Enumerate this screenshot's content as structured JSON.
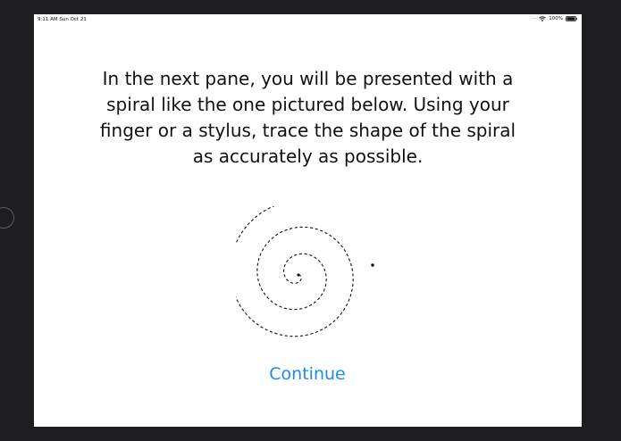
{
  "status_bar": {
    "time_date": "9:11 AM  Sun Oct 21",
    "battery_percent": "100%",
    "signal": "·····",
    "wifi_icon": "wifi-icon",
    "battery_icon": "battery-full-icon"
  },
  "content": {
    "instruction_lines": [
      "In the next pane, you will be presented with a",
      "spiral like the one pictured below.  Using your",
      "finger or a stylus, trace the shape of the spiral",
      "as accurately as possible."
    ],
    "continue_label": "Continue"
  },
  "colors": {
    "accent": "#1a8cf0",
    "text": "#111111",
    "bezel": "#1e1e20",
    "screen": "#ffffff"
  }
}
